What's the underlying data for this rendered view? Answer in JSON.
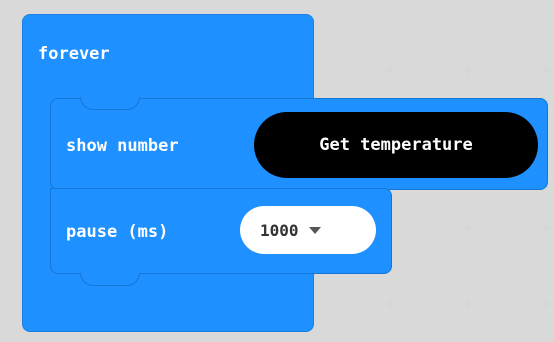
{
  "blocks": {
    "forever": {
      "label": "forever"
    },
    "show_number": {
      "label": "show number",
      "reporter": {
        "label": "Get temperature"
      }
    },
    "pause": {
      "label": "pause (ms)",
      "dropdown": {
        "value": "1000"
      }
    }
  },
  "colors": {
    "block_blue": "#1e90ff",
    "reporter_black": "#000000",
    "workspace_bg": "#ececec"
  },
  "icons": {
    "dropdown_arrow": "triangle-down-icon"
  }
}
